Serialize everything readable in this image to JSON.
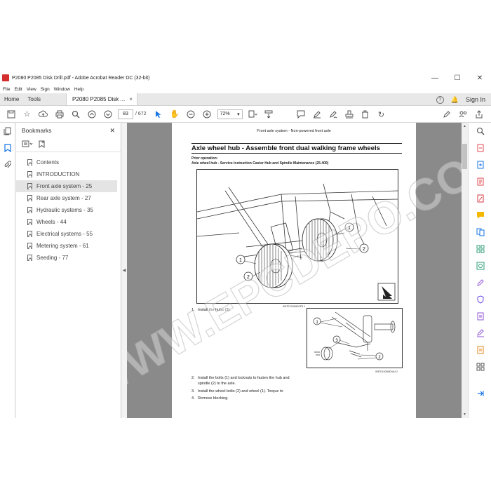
{
  "window": {
    "title": "P2080 P2085 Disk Drill.pdf - Adobe Acrobat Reader DC (32-bit)",
    "minimize": "—",
    "maximize": "☐",
    "close": "✕"
  },
  "menu": [
    "File",
    "Edit",
    "View",
    "Sign",
    "Window",
    "Help"
  ],
  "tabs": {
    "home": "Home",
    "tools": "Tools",
    "document": "P2080 P2085 Disk ...",
    "close": "×",
    "help": "?",
    "notify": "🔔",
    "sign_in": "Sign In"
  },
  "toolbar": {
    "page_current": "83",
    "page_total": "/ 672",
    "zoom": "72%",
    "zoom_arrow": "▾"
  },
  "bookmarks": {
    "title": "Bookmarks",
    "close": "✕",
    "items": [
      {
        "label": "Contents",
        "selected": false
      },
      {
        "label": "INTRODUCTION",
        "selected": false
      },
      {
        "label": "Front axle system - 25",
        "selected": true
      },
      {
        "label": "Rear axle system - 27",
        "selected": false
      },
      {
        "label": "Hydraulic systems - 35",
        "selected": false
      },
      {
        "label": "Wheels - 44",
        "selected": false
      },
      {
        "label": "Electrical systems - 55",
        "selected": false
      },
      {
        "label": "Metering system - 61",
        "selected": false
      },
      {
        "label": "Seeding - 77",
        "selected": false
      }
    ]
  },
  "page": {
    "header": "Front axle system - Non-powered front axle",
    "title": "Axle wheel hub - Assemble front dual walking frame wheels",
    "prior_label": "Prior operation:",
    "prior_text": "Axle wheel hub - Service instruction Caster Hub and Spindle Maintenance (25.400)",
    "fig1_caption": "SMTE1003MD2P3   1",
    "fig2_caption": "SMTE1003MD0A4   2",
    "steps": [
      {
        "num": "1.",
        "text": "Install the hubs (3)."
      },
      {
        "num": "2.",
        "text": "Install the bolts (1) and locknuts to fasten the hub and"
      },
      {
        "num": "",
        "text": "spindle (2) to the axle."
      },
      {
        "num": "3.",
        "text": "Install the wheel bolts (2) and wheel (1). Torque to"
      },
      {
        "num": "4.",
        "text": "Remove blocking."
      }
    ],
    "callouts": [
      "1",
      "2",
      "3"
    ]
  },
  "watermark": "WWW.EPCDEPO.COM",
  "colors": {
    "accent": "#1473e6",
    "acrobat_red": "#d32f2f",
    "doc_bg": "#8a8a8a"
  }
}
